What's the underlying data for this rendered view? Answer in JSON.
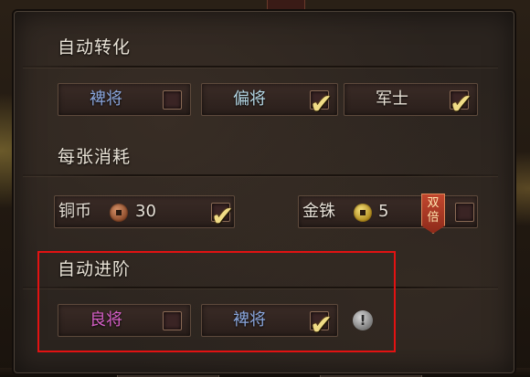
{
  "sections": {
    "auto_convert": {
      "title": "自动转化",
      "options": [
        {
          "label": "裨将",
          "checked": false,
          "color": "#8aa6dc"
        },
        {
          "label": "偏将",
          "checked": true,
          "color": "#b5d8e6"
        },
        {
          "label": "军士",
          "checked": true,
          "color": "#e8e2d6"
        }
      ]
    },
    "cost_per_card": {
      "title": "每张消耗",
      "options": [
        {
          "label": "铜币",
          "amount": "30",
          "checked": true,
          "coin": "copper-coin-icon"
        },
        {
          "label": "金铢",
          "amount": "5",
          "checked": false,
          "coin": "gold-coin-icon",
          "badge": [
            "双",
            "倍"
          ]
        }
      ]
    },
    "auto_advance": {
      "title": "自动进阶",
      "options": [
        {
          "label": "良将",
          "checked": false,
          "color": "#d55fc6"
        },
        {
          "label": "裨将",
          "checked": true,
          "color": "#8aa6dc"
        }
      ],
      "info_symbol": "!"
    }
  },
  "check_glyph": "✔",
  "highlight_color": "#e21212"
}
